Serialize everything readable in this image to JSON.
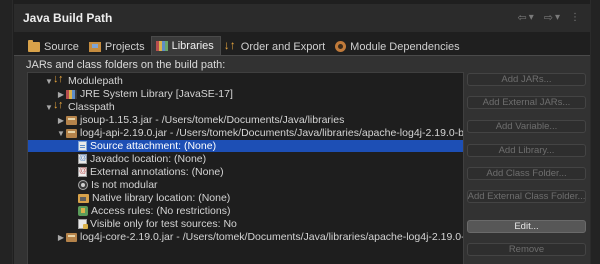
{
  "window": {
    "title": "Java Build Path"
  },
  "tabs": [
    {
      "label": "Source",
      "icon": "folder-icon"
    },
    {
      "label": "Projects",
      "icon": "project-icon"
    },
    {
      "label": "Libraries",
      "icon": "libraries-icon",
      "active": true
    },
    {
      "label": "Order and Export",
      "icon": "order-export-icon"
    },
    {
      "label": "Module Dependencies",
      "icon": "module-icon"
    }
  ],
  "panel": {
    "label": "JARs and class folders on the build path:"
  },
  "tree": [
    {
      "text": "Modulepath",
      "expanded": true,
      "icon": "build-path-order-icon"
    },
    {
      "text": "JRE System Library [JavaSE-17]",
      "expanded": false,
      "icon": "library-icon"
    },
    {
      "text": "Classpath",
      "expanded": true,
      "icon": "build-path-order-icon"
    },
    {
      "text": "jsoup-1.15.3.jar - /Users/tomek/Documents/Java/libraries",
      "expanded": false,
      "icon": "jar-icon"
    },
    {
      "text": "log4j-api-2.19.0.jar - /Users/tomek/Documents/Java/libraries/apache-log4j-2.19.0-bin",
      "expanded": true,
      "icon": "jar-icon"
    },
    {
      "text": "Source attachment: (None)",
      "icon": "source-attachment-icon",
      "selected": true
    },
    {
      "text": "Javadoc location: (None)",
      "icon": "javadoc-icon"
    },
    {
      "text": "External annotations: (None)",
      "icon": "annotations-icon"
    },
    {
      "text": "Is not modular",
      "icon": "module-icon"
    },
    {
      "text": "Native library location: (None)",
      "icon": "native-library-icon"
    },
    {
      "text": "Access rules: (No restrictions)",
      "icon": "access-rules-icon"
    },
    {
      "text": "Visible only for test sources: No",
      "icon": "test-sources-icon"
    },
    {
      "text": "log4j-core-2.19.0.jar - /Users/tomek/Documents/Java/libraries/apache-log4j-2.19.0-bin",
      "expanded": false,
      "icon": "jar-icon"
    }
  ],
  "buttons": {
    "add_jars": "Add JARs...",
    "add_external_jars": "Add External JARs...",
    "add_variable": "Add Variable...",
    "add_library": "Add Library...",
    "add_class_folder": "Add Class Folder...",
    "add_external_class_folder": "Add External Class Folder...",
    "edit": "Edit...",
    "remove": "Remove"
  },
  "colors": {
    "selection": "#1d4fb5",
    "tree_background": "#1e1e1e",
    "panel_background": "#323232"
  }
}
